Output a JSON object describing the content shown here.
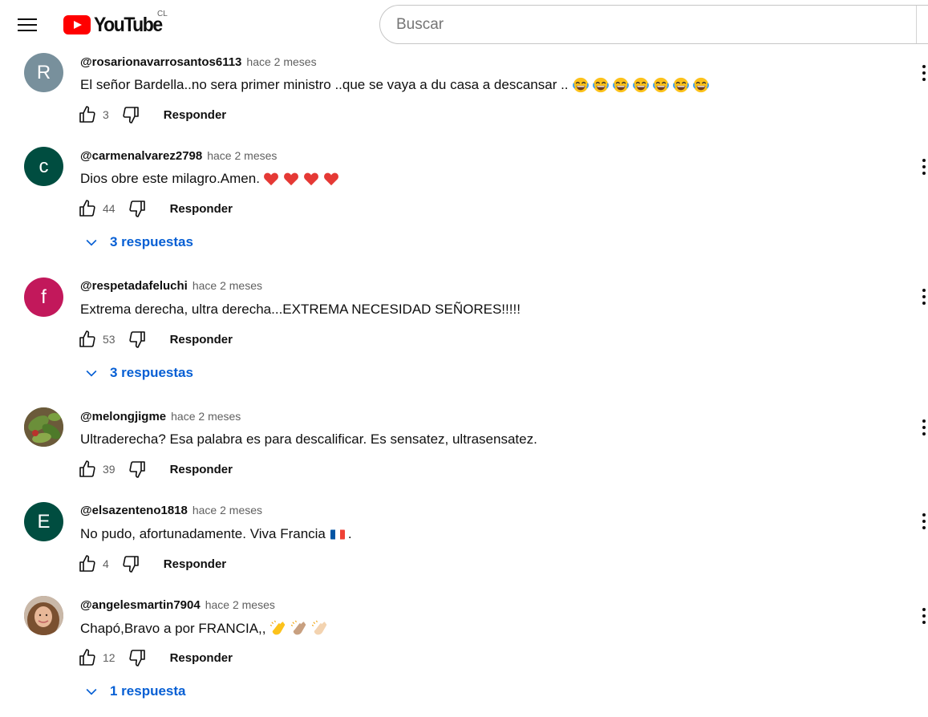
{
  "header": {
    "logo_text": "YouTube",
    "country_code": "CL",
    "search_placeholder": "Buscar"
  },
  "comments": [
    {
      "initial": "R",
      "avatar_color": "#78909c",
      "author": "@rosarionavarrosantos6113",
      "time": "hace 2 meses",
      "text": "El señor Bardella..no sera primer ministro ..que se vaya a du casa a descansar ..",
      "emoji": "laugh x7",
      "likes": "3",
      "reply_label": "Responder"
    },
    {
      "initial": "c",
      "avatar_color": "#004d40",
      "author": "@carmenalvarez2798",
      "time": "hace 2 meses",
      "text": "Dios obre este milagro.Amen.",
      "emoji": "heart x4",
      "likes": "44",
      "reply_label": "Responder",
      "replies": "3 respuestas"
    },
    {
      "initial": "f",
      "avatar_color": "#c2185b",
      "author": "@respetadafeluchi",
      "time": "hace 2 meses",
      "text": "Extrema derecha, ultra derecha...EXTREMA NECESIDAD SEÑORES!!!!!",
      "likes": "53",
      "reply_label": "Responder",
      "replies": "3 respuestas"
    },
    {
      "avatar_color": "#5d7a3a",
      "author": "@melongjigme",
      "time": "hace 2 meses",
      "text": "Ultraderecha? Esa palabra es para descalificar. Es sensatez, ultrasensatez.",
      "likes": "39",
      "reply_label": "Responder"
    },
    {
      "initial": "E",
      "avatar_color": "#004d40",
      "author": "@elsazenteno1818",
      "time": "hace 2 meses",
      "text": "No pudo, afortunadamente. Viva Francia",
      "text_suffix": ".",
      "emoji": "flag-france",
      "likes": "4",
      "reply_label": "Responder"
    },
    {
      "avatar_color": "#a07860",
      "author": "@angelesmartin7904",
      "time": "hace 2 meses",
      "text": "Chapó,Bravo a por FRANCIA,,",
      "emoji": "clap x3",
      "likes": "12",
      "reply_label": "Responder",
      "replies": "1 respuesta"
    }
  ],
  "colors": {
    "link_blue": "#065fd4",
    "brand_red": "#ff0000"
  }
}
